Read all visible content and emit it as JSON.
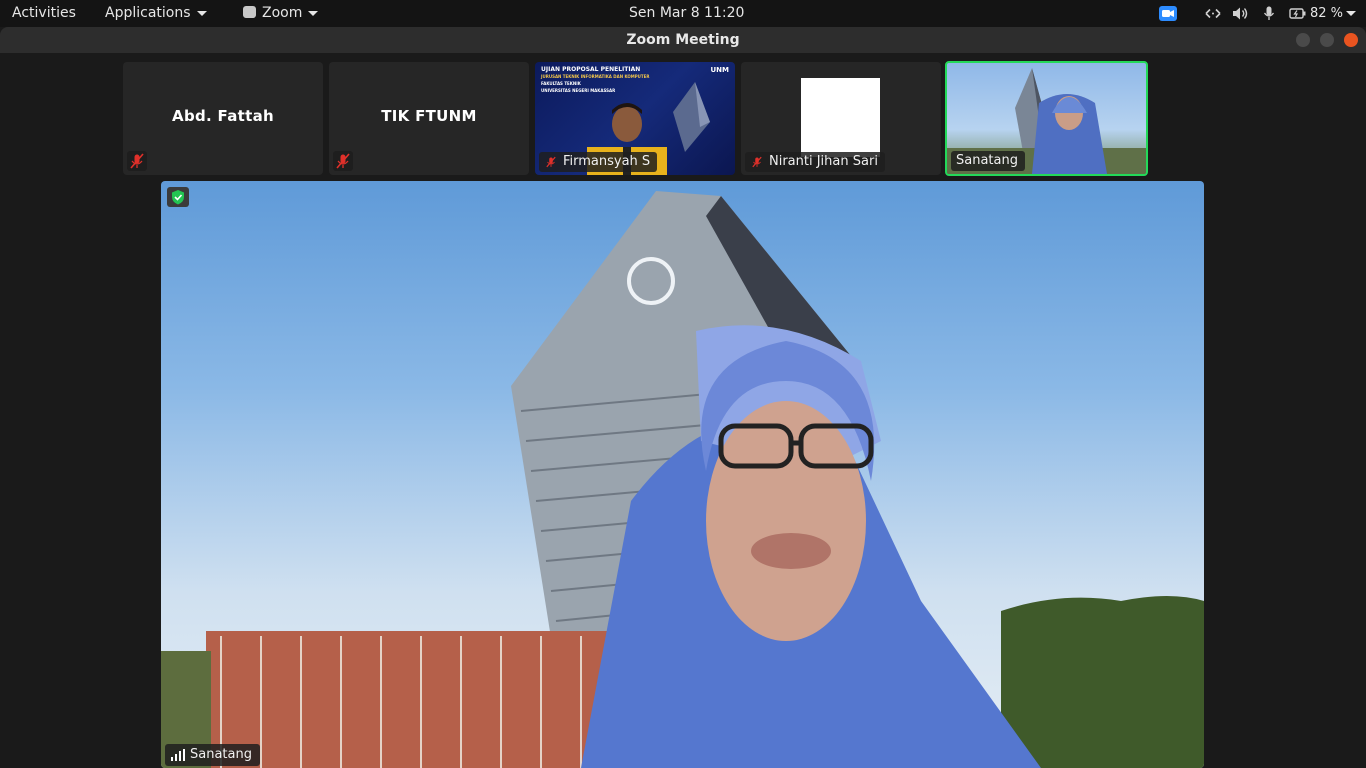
{
  "topbar": {
    "activities": "Activities",
    "applications": "Applications",
    "app_name": "Zoom",
    "clock": "Sen Mar 8  11:20",
    "battery": "82 %"
  },
  "window": {
    "title": "Zoom Meeting"
  },
  "participants": [
    {
      "name": "Abd. Fattah",
      "muted": true,
      "video": false
    },
    {
      "name": "TIK FTUNM",
      "muted": true,
      "video": false
    },
    {
      "name": "Firmansyah S",
      "muted": true,
      "video": true
    },
    {
      "name": "Niranti Jihan Sari",
      "muted": true,
      "video": false
    },
    {
      "name": "Sanatang",
      "muted": false,
      "video": true,
      "active_speaker": true
    }
  ],
  "slide_overlay": {
    "title": "UJIAN PROPOSAL PENELITIAN",
    "line2": "JURUSAN TEKNIK INFORMATIKA DAN KOMPUTER",
    "line3": "FAKULTAS TEKNIK",
    "line4": "UNIVERSITAS NEGERI MAKASSAR",
    "logo": "UNM"
  },
  "main_video": {
    "speaker_name": "Sanatang"
  },
  "colors": {
    "active_border": "#23d959",
    "mute_red": "#e0302a",
    "close_button": "#e95420"
  }
}
